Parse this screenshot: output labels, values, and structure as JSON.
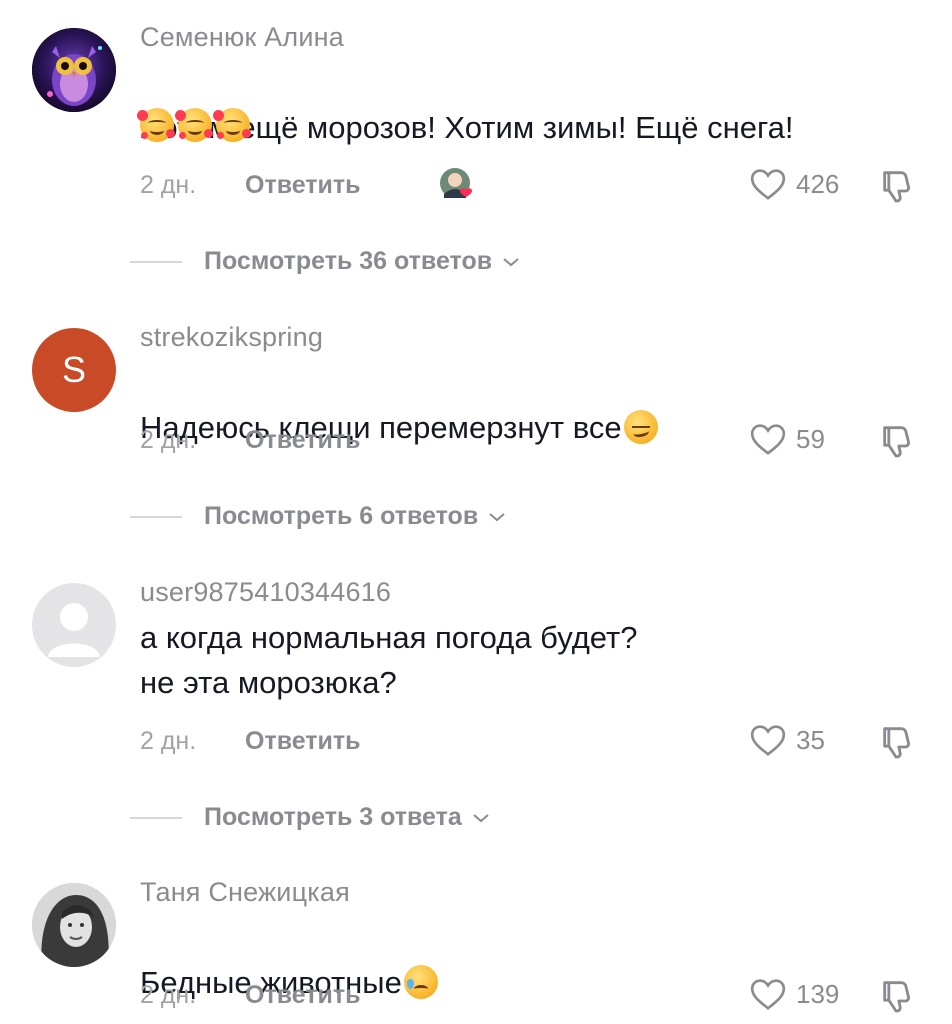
{
  "comments": [
    {
      "author": "Семенюк Алина",
      "text": "Хотим ещё морозов! Хотим зимы! Ещё снега!",
      "emoji_icons": [
        "smiling-face-with-hearts-icon",
        "smiling-face-with-hearts-icon",
        "smiling-face-with-hearts-icon"
      ],
      "time": "2 дн.",
      "reply_label": "Ответить",
      "likes": "426",
      "view_replies": "Посмотреть 36 ответов",
      "avatar_icon": "owl-avatar-icon",
      "creator_liked": true
    },
    {
      "author": "strekozikspring",
      "text": "Надеюсь клещи перемерзнут все",
      "emoji_icons": [
        "smirking-face-icon"
      ],
      "time": "2 дн.",
      "reply_label": "Ответить",
      "likes": "59",
      "view_replies": "Посмотреть 6 ответов",
      "avatar_letter": "S",
      "avatar_color": "#c94a26"
    },
    {
      "author": "user9875410344616",
      "text": "а когда нормальная погода будет?\nне эта морозюка?",
      "time": "2 дн.",
      "reply_label": "Ответить",
      "likes": "35",
      "view_replies": "Посмотреть 3 ответа",
      "avatar_icon": "default-user-avatar-icon"
    },
    {
      "author": "Таня Снежицкая",
      "text": "Бедные животные",
      "emoji_icons": [
        "sad-but-relieved-face-icon"
      ],
      "time": "2 дн.",
      "reply_label": "Ответить",
      "likes": "139",
      "avatar_icon": "photo-avatar-icon"
    }
  ],
  "colors": {
    "text_primary": "#161823",
    "text_secondary": "#8a8b91",
    "heart_red": "#fe2c55"
  }
}
